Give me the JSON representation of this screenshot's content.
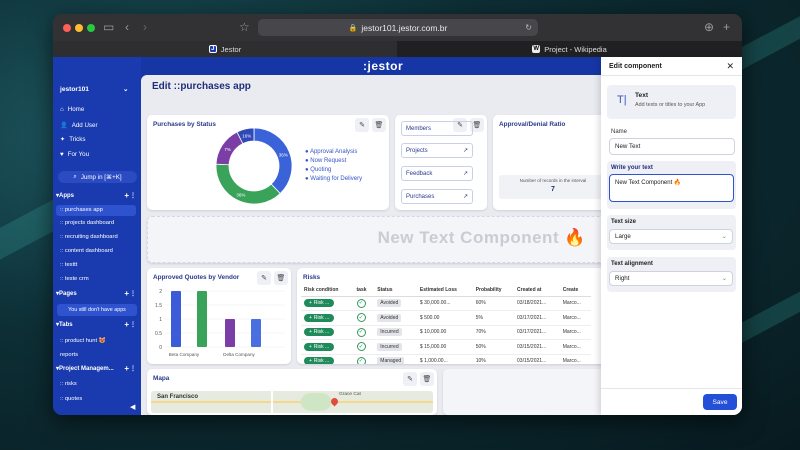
{
  "browser": {
    "url": "jestor101.jestor.com.br",
    "tabs": [
      {
        "label": "Jestor",
        "favicon": "J"
      },
      {
        "label": "Project - Wikipedia",
        "favicon": "W"
      }
    ]
  },
  "app": {
    "brand": ":jestor",
    "page_title": "Edit ::purchases app"
  },
  "sidebar": {
    "workspace": "jestor101",
    "nav": [
      {
        "label": "Home",
        "icon": "home-icon"
      },
      {
        "label": "Add User",
        "icon": "add-user-icon"
      },
      {
        "label": "Tricks",
        "icon": "tricks-icon"
      },
      {
        "label": "For You",
        "icon": "heart-icon"
      }
    ],
    "jump_label": "Jump in [⌘+K]",
    "apps_title": "Apps",
    "apps": [
      ":: purchases app",
      ":: projects dashboard",
      ":: recruiting dashboard",
      ":: content dashboard",
      ":: testtt",
      ":: teste crm"
    ],
    "pages_title": "Pages",
    "pages_empty": "You still don't have apps",
    "tabs_title": "Tabs",
    "tabs": [
      ":: product hunt 😻",
      "reports"
    ],
    "project_title": "Project Managem...",
    "project_items": [
      ":: risks",
      ":: quotes"
    ]
  },
  "purchases_by_status": {
    "title": "Purchases by Status",
    "legend": [
      "Approval Analysis",
      "Now Request",
      "Quoting",
      "Waiting for Delivery"
    ],
    "colors": [
      "#3b63d9",
      "#3aa35a",
      "#7a3ea6",
      "#2f49b8"
    ],
    "slice_labels": [
      "36%",
      "36%",
      "7%",
      "16%"
    ],
    "values": [
      36,
      36,
      16,
      7
    ]
  },
  "links_card": {
    "buttons": [
      "Members",
      "Projects",
      "Feedback",
      "Purchases"
    ]
  },
  "approval_card": {
    "title": "Approval/Denial Ratio",
    "metric_label": "Number of records in the interval",
    "metric_value": "7"
  },
  "text_component": {
    "text": "New Text Component 🔥"
  },
  "approved_quotes": {
    "title": "Approved Quotes by Vendor",
    "y_ticks": [
      "2",
      "1.5",
      "1",
      "0.5",
      "0"
    ],
    "categories": [
      "Beta Company",
      "Delta Company"
    ],
    "series_colors": [
      "#3b5bd8",
      "#3aa35a",
      "#7a3ea6",
      "#4a6fe0"
    ],
    "values": [
      2,
      2,
      1,
      1
    ]
  },
  "risks": {
    "title": "Risks",
    "columns": [
      "Risk condition",
      "task",
      "Status",
      "Estimated Loss",
      "Probability",
      "Created at",
      "Create"
    ],
    "risk_label": "Risk ...",
    "rows": [
      {
        "status": "Avoided",
        "loss": "$ 30,000.00...",
        "prob": "60%",
        "created": "03/18/2021...",
        "by": "Marco..."
      },
      {
        "status": "Avoided",
        "loss": "$ 500.00",
        "prob": "5%",
        "created": "03/17/2021...",
        "by": "Marco..."
      },
      {
        "status": "Incurred",
        "loss": "$ 10,000.00",
        "prob": "70%",
        "created": "03/17/2021...",
        "by": "Marco..."
      },
      {
        "status": "Incurred",
        "loss": "$ 15,000.00",
        "prob": "50%",
        "created": "03/15/2021...",
        "by": "Marco..."
      },
      {
        "status": "Managed",
        "loss": "$ 1,000.00...",
        "prob": "10%",
        "created": "03/15/2021...",
        "by": "Marco..."
      }
    ]
  },
  "mapa": {
    "title": "Mapa",
    "city": "San Francisco",
    "poi": "Grace Cat"
  },
  "edit_panel": {
    "title": "Edit component",
    "component_name": "Text",
    "component_desc": "Add texts or titles to your App",
    "name_label": "Name",
    "name_value": "New Text",
    "write_label": "Write your text",
    "write_value": "New Text Component 🔥",
    "size_label": "Text size",
    "size_value": "Large",
    "align_label": "Text alignment",
    "align_value": "Right",
    "save_label": "Save"
  }
}
